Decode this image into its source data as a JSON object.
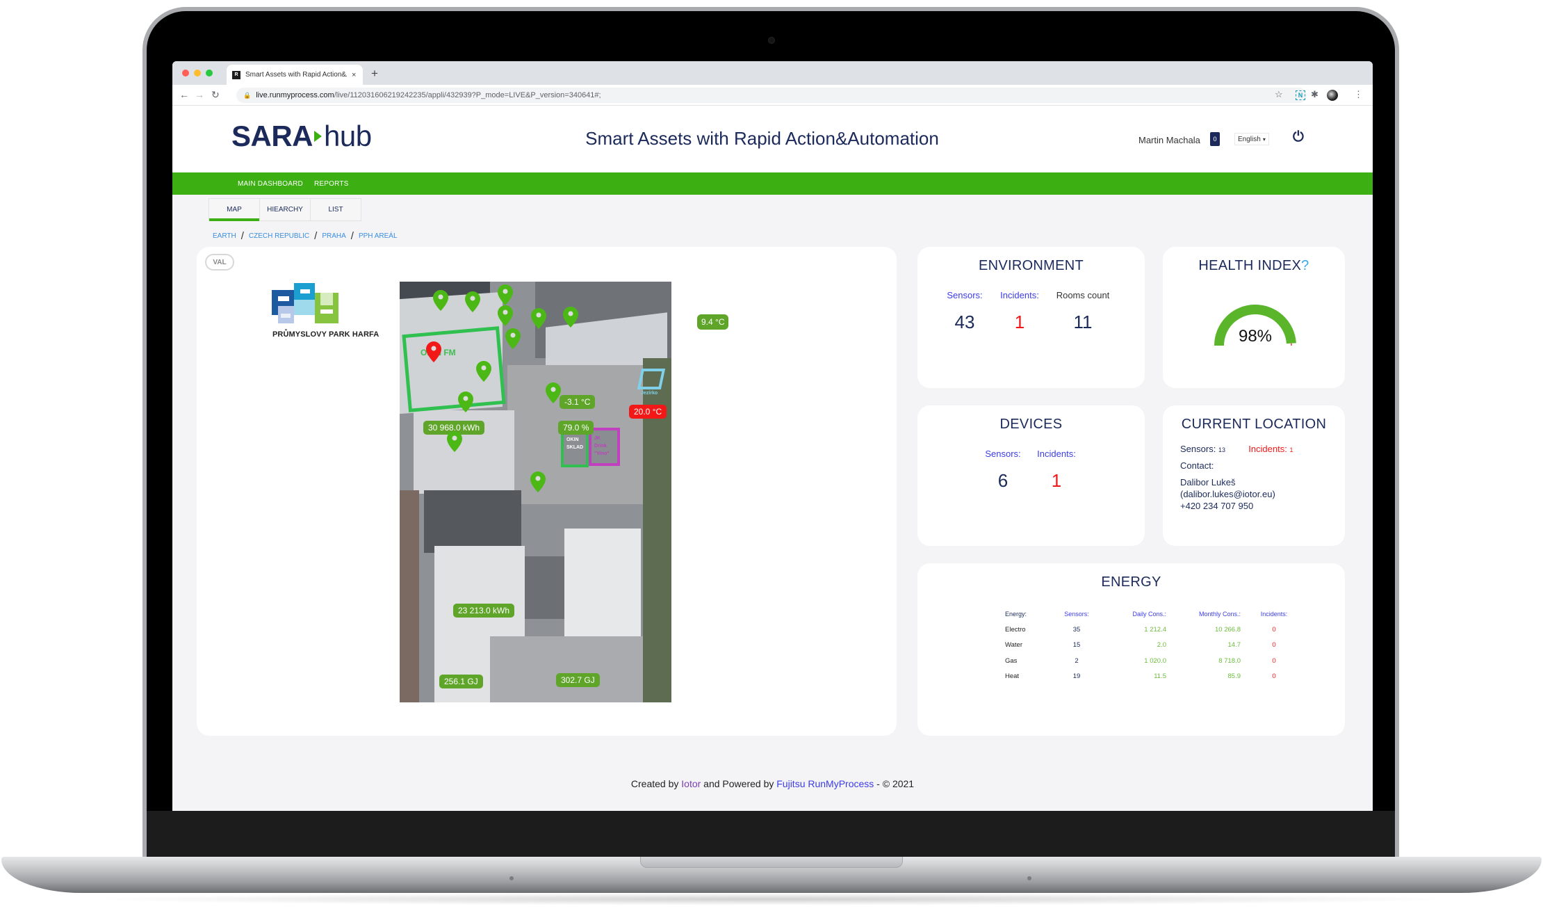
{
  "browser": {
    "tab_title": "Smart Assets with Rapid Action&Automation",
    "tab_favicon_letter": "R",
    "new_tab_symbol": "+",
    "close_symbol": "×",
    "url_host": "live.runmyprocess.com",
    "url_path": "/live/112031606219242235/appli/432939?P_mode=LIVE&P_version=340641#;",
    "extension_letter": "N"
  },
  "header": {
    "logo_bold": "SARA",
    "logo_light": "hub",
    "title": "Smart Assets with Rapid Action&Automation",
    "user_name": "Martin Machala",
    "notification_count": "0",
    "language": "English"
  },
  "nav": {
    "items": [
      "MAIN DASHBOARD",
      "REPORTS"
    ]
  },
  "view_tabs": [
    {
      "label": "MAP",
      "active": true
    },
    {
      "label": "HIEARCHY",
      "active": false
    },
    {
      "label": "LIST",
      "active": false
    }
  ],
  "breadcrumb": [
    "EARTH",
    "CZECH REPUBLIC",
    "PRAHA",
    "PPH AREÁL"
  ],
  "map_card": {
    "val_chip": "VAL",
    "site_logo_caption": "PRŮMYSLOVY PARK HARFA",
    "outside_label": "9.4 °C",
    "zones": [
      {
        "name": "OKIN FM",
        "color": "#30c050"
      },
      {
        "name": "OKIN SKLAD",
        "color": "#30c050"
      },
      {
        "name": "JK Drink \"Vino\"",
        "color": "#c040c0"
      },
      {
        "name": "Jezírko",
        "color": "#7fd0e8"
      }
    ],
    "labels": [
      {
        "text": "30 968.0 kWh",
        "status": "ok"
      },
      {
        "text": "-3.1 °C",
        "status": "ok"
      },
      {
        "text": "79.0 %",
        "status": "ok"
      },
      {
        "text": "20.0 °C",
        "status": "alert"
      },
      {
        "text": "23 213.0 kWh",
        "status": "ok"
      },
      {
        "text": "256.1 GJ",
        "status": "ok"
      },
      {
        "text": "302.7 GJ",
        "status": "ok"
      }
    ],
    "pins": {
      "ok_count": 13,
      "alert_count": 1,
      "ok_color": "#4cb816",
      "alert_color": "#f21818"
    }
  },
  "environment": {
    "title": "ENVIRONMENT",
    "sensors_label": "Sensors:",
    "incidents_label": "Incidents:",
    "rooms_label": "Rooms count",
    "sensors": "43",
    "incidents": "1",
    "rooms": "11"
  },
  "health": {
    "title": "HEALTH INDEX",
    "help": "?",
    "value_text": "98%",
    "value_fraction": 0.98,
    "good_color": "#5ab52a",
    "bad_color": "#f26b6b"
  },
  "devices": {
    "title": "DEVICES",
    "sensors_label": "Sensors:",
    "incidents_label": "Incidents:",
    "sensors": "6",
    "incidents": "1"
  },
  "location": {
    "title": "CURRENT LOCATION",
    "sensors_label": "Sensors:",
    "sensors": "13",
    "incidents_label": "Incidents:",
    "incidents": "1",
    "contact_label": "Contact:",
    "contact_name": "Dalibor Lukeš",
    "contact_email": "(dalibor.lukes@iotor.eu)",
    "contact_phone": "+420 234 707 950"
  },
  "energy": {
    "title": "ENERGY",
    "headers": [
      "Energy:",
      "Sensors:",
      "Daily Cons.:",
      "Monthly Cons.:",
      "Incidents:"
    ],
    "rows": [
      [
        "Electro",
        "35",
        "1 212.4",
        "10 266.8",
        "0"
      ],
      [
        "Water",
        "15",
        "2.0",
        "14.7",
        "0"
      ],
      [
        "Gas",
        "2",
        "1 020.0",
        "8 718.0",
        "0"
      ],
      [
        "Heat",
        "19",
        "11.5",
        "85.9",
        "0"
      ]
    ]
  },
  "footer": {
    "prefix": "Created by ",
    "creator": "Iotor",
    "middle": " and Powered by ",
    "platform": "Fujitsu RunMyProcess",
    "suffix": " - © 2021"
  }
}
